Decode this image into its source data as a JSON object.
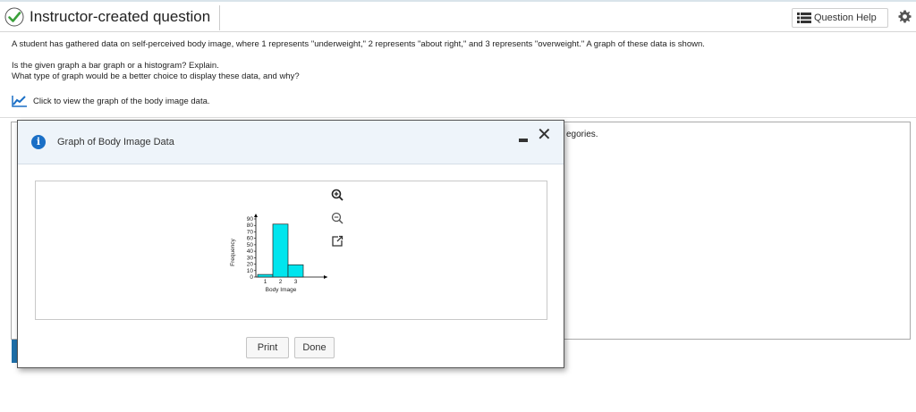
{
  "header": {
    "title": "Instructor-created question",
    "help_label": "Question Help"
  },
  "question": {
    "line1": "A student has gathered data on self-perceived body image, where 1 represents \"underweight,\" 2 represents \"about right,\" and 3 represents \"overweight.\" A graph of these data is shown.",
    "line2": "Is the given graph a bar graph or a histogram? Explain.",
    "line3": "What type of graph would be a better choice to display these data, and why?",
    "graph_link": "Click to view the graph of the body image data."
  },
  "answer": {
    "partial_text": "egories."
  },
  "dialog": {
    "title": "Graph of Body Image Data",
    "print_label": "Print",
    "done_label": "Done"
  },
  "chart_data": {
    "type": "bar",
    "categories": [
      "1",
      "2",
      "3"
    ],
    "values": [
      4,
      82,
      19
    ],
    "xlabel": "Body Image",
    "ylabel": "Frequency",
    "ylim": [
      0,
      90
    ],
    "yticks": [
      "0",
      "10",
      "20",
      "30",
      "40",
      "50",
      "60",
      "70",
      "80",
      "90"
    ],
    "bar_color": "#00e5ee"
  },
  "colors": {
    "accent": "#1a6fc6",
    "check": "#3ba03b"
  }
}
